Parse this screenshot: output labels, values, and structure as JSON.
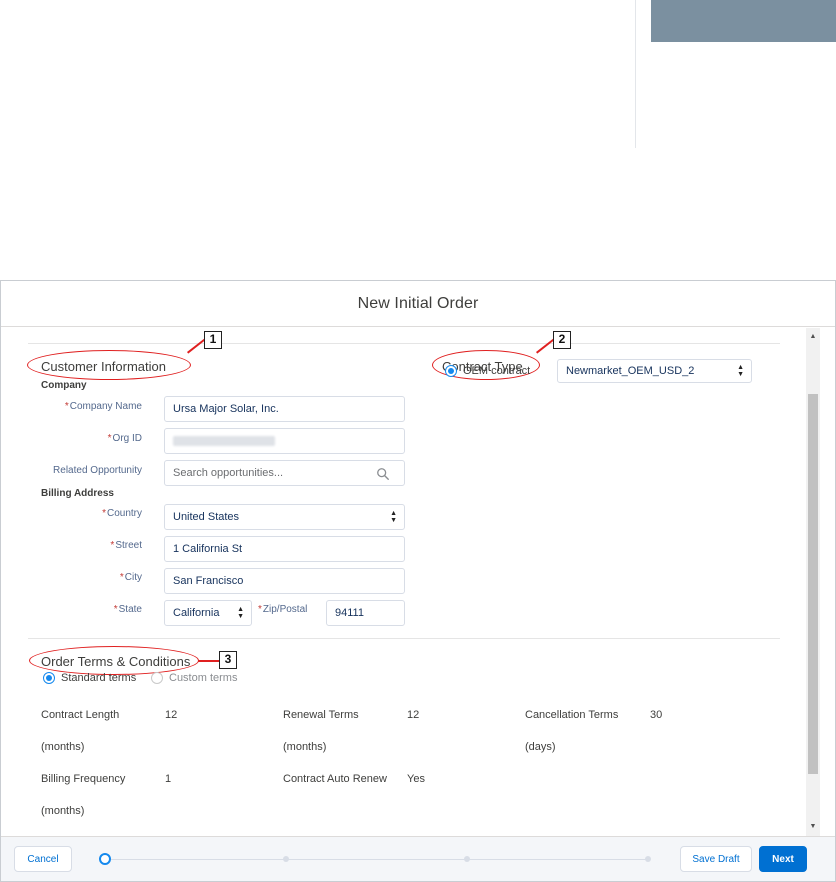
{
  "modal": {
    "title": "New Initial Order"
  },
  "annotations": [
    "1",
    "2",
    "3"
  ],
  "customer_info": {
    "title": "Customer Information",
    "company_heading": "Company",
    "company_name_label": "Company Name",
    "company_name_value": "Ursa Major Solar, Inc.",
    "org_id_label": "Org ID",
    "related_opportunity_label": "Related Opportunity",
    "related_opportunity_placeholder": "Search opportunities...",
    "billing_heading": "Billing Address",
    "country_label": "Country",
    "country_value": "United States",
    "street_label": "Street",
    "street_value": "1 California St",
    "city_label": "City",
    "city_value": "San Francisco",
    "state_label": "State",
    "state_value": "California",
    "zip_label": "Zip/Postal",
    "zip_value": "94111"
  },
  "contract_type": {
    "title": "Contract Type",
    "option_label": "OEM contract",
    "contract_value": "Newmarket_OEM_USD_2"
  },
  "order_terms": {
    "title": "Order Terms & Conditions",
    "standard_label": "Standard terms",
    "custom_label": "Custom terms",
    "contract_length_label": "Contract Length",
    "contract_length_unit": "(months)",
    "contract_length_value": "12",
    "renewal_terms_label": "Renewal Terms",
    "renewal_terms_unit": "(months)",
    "renewal_terms_value": "12",
    "cancellation_terms_label": "Cancellation Terms",
    "cancellation_terms_unit": "(days)",
    "cancellation_terms_value": "30",
    "billing_frequency_label": "Billing Frequency",
    "billing_frequency_unit": "(months)",
    "billing_frequency_value": "1",
    "auto_renew_label": "Contract Auto Renew",
    "auto_renew_value": "Yes"
  },
  "footer": {
    "cancel_label": "Cancel",
    "save_draft_label": "Save Draft",
    "next_label": "Next"
  },
  "progress": {
    "current_step": 1,
    "total_steps": 4
  },
  "colors": {
    "brand": "#0070d2",
    "radio_selected": "#1589ee",
    "required": "#c23934",
    "annotation": "#e02020"
  },
  "icons": {
    "search": "search-icon",
    "select": "select-arrows-icon",
    "scroll_up": "scroll-up-icon",
    "scroll_down": "scroll-down-icon"
  }
}
